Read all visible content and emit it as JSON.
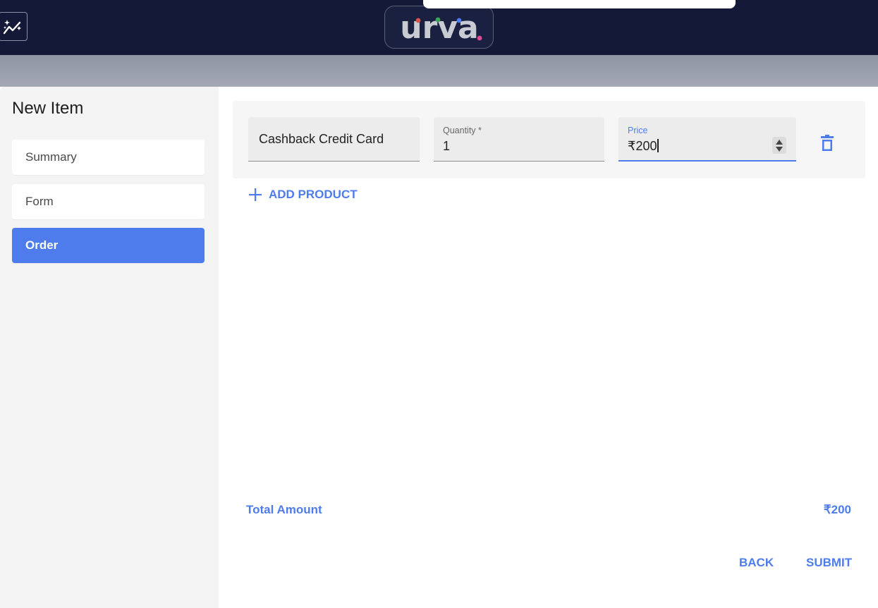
{
  "header": {
    "logo_text": "urva",
    "trend_icon": "trending-sparkle-icon"
  },
  "dialog": {
    "title": "New Item"
  },
  "sidebar": {
    "items": [
      {
        "label": "Summary",
        "active": false
      },
      {
        "label": "Form",
        "active": false
      },
      {
        "label": "Order",
        "active": true
      }
    ]
  },
  "product": {
    "name_value": "Cashback Credit Card",
    "quantity_label": "Quantity *",
    "quantity_value": "1",
    "price_label": "Price",
    "price_value": "₹200",
    "delete_icon": "trash-icon"
  },
  "actions": {
    "add_product_label": "ADD PRODUCT",
    "back_label": "BACK",
    "submit_label": "SUBMIT"
  },
  "totals": {
    "label": "Total Amount",
    "value": "₹200"
  },
  "colors": {
    "topbar": "#141938",
    "accent": "#4e7ced",
    "sidebar_bg": "#f4f4f4"
  }
}
